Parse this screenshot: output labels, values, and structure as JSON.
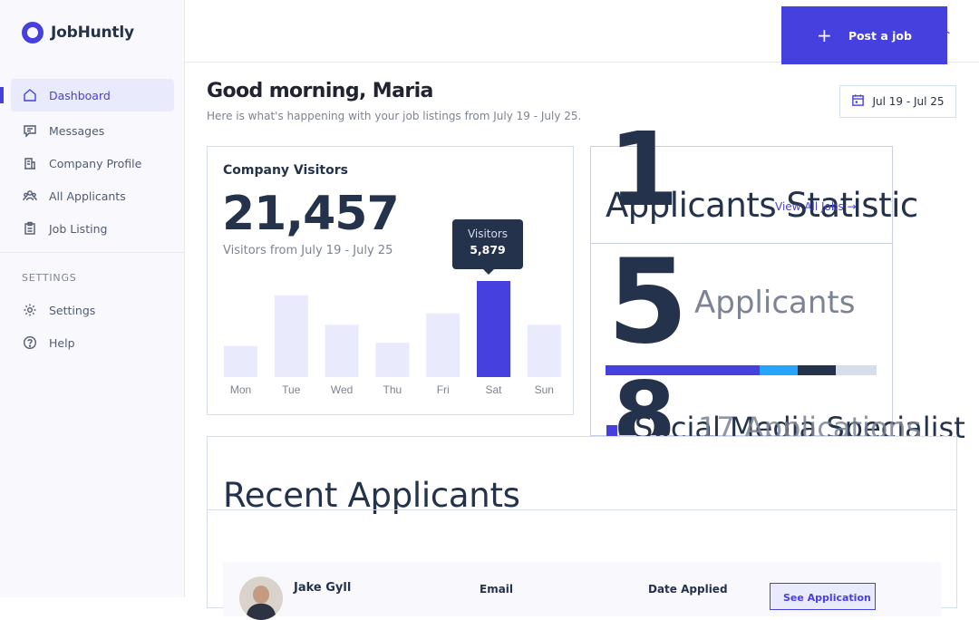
{
  "brand": {
    "name": "JobHuntly",
    "accent": "#4640de"
  },
  "sidebar": {
    "items": [
      {
        "label": "Dashboard",
        "icon": "home-icon"
      },
      {
        "label": "Messages",
        "icon": "message-icon"
      },
      {
        "label": "Company Profile",
        "icon": "building-icon"
      },
      {
        "label": "All Applicants",
        "icon": "users-icon"
      },
      {
        "label": "Job Listing",
        "icon": "clipboard-icon"
      }
    ],
    "section_title": "SETTINGS",
    "settings_items": [
      {
        "label": "Settings",
        "icon": "gear-icon"
      },
      {
        "label": "Help",
        "icon": "help-icon"
      }
    ]
  },
  "header": {
    "post_job_label": "Post a job",
    "greeting": "Good morning, Maria",
    "subtitle": "Here is what's happening with your job listings from July 19 - July 25.",
    "date_range": "Jul 19 - Jul 25"
  },
  "visitors": {
    "title": "Company Visitors",
    "total": "21,457",
    "subtitle": "Visitors from July 19 - July 25",
    "tooltip_label": "Visitors",
    "tooltip_value": "5,879"
  },
  "chart_data": {
    "type": "bar",
    "categories": [
      "Mon",
      "Tue",
      "Wed",
      "Thu",
      "Fri",
      "Sat",
      "Sun"
    ],
    "values": [
      1900,
      5000,
      3200,
      2100,
      3900,
      5879,
      3200
    ],
    "highlight_index": 5,
    "colors": {
      "bar": "#e9ebfd",
      "highlight": "#4640de"
    }
  },
  "stats": {
    "big_digit_1": "1",
    "title": "Applicants Statistic",
    "view_all": "View All Jobs",
    "count": "5",
    "count_label": "Applicants",
    "progress_segments": [
      {
        "value": 57,
        "color": "#4640de"
      },
      {
        "value": 14,
        "color": "#26a4ff"
      },
      {
        "value": 14,
        "color": "#25324b"
      },
      {
        "value": 15,
        "color": "#d6ddeb"
      }
    ],
    "big_digit_8": "8",
    "overlap_text_a": "Social Media Specialist",
    "overlap_text_b": "17 Applications"
  },
  "recent": {
    "title": "Recent Applicants",
    "applicant_name": "Jake Gyll",
    "col_email": "Email",
    "col_date": "Date Applied",
    "see_application": "See Application"
  }
}
